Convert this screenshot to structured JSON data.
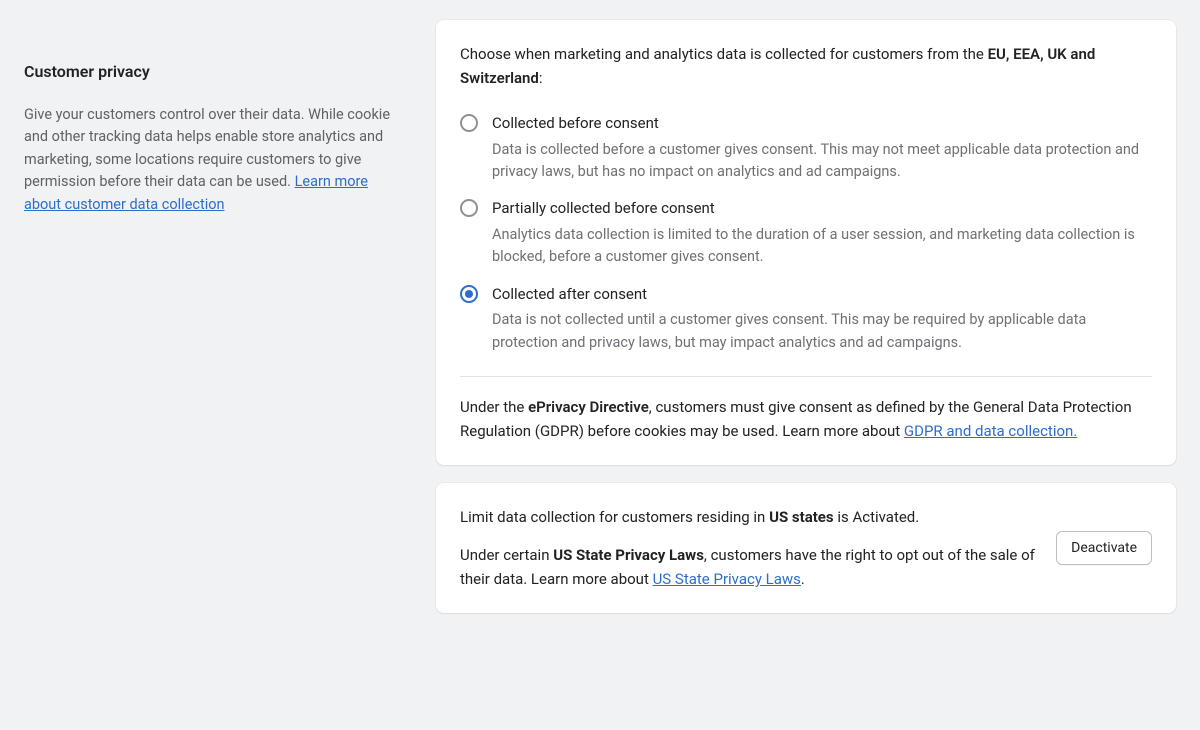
{
  "sidebar": {
    "title": "Customer privacy",
    "description": "Give your customers control over their data. While cookie and other tracking data helps enable store analytics and marketing, some locations require customers to give permission before their data can be used. ",
    "learn_more_link": "Learn more about customer data collection"
  },
  "card1": {
    "intro_prefix": "Choose when marketing and analytics data is collected for customers from the ",
    "intro_bold": "EU, EEA, UK and Switzerland",
    "intro_suffix": ":",
    "options": [
      {
        "label": "Collected before consent",
        "desc": "Data is collected before a customer gives consent. This may not meet applicable data protection and privacy laws, but has no impact on analytics and ad campaigns.",
        "selected": false
      },
      {
        "label": "Partially collected before consent",
        "desc": "Analytics data collection is limited to the duration of a user session, and marketing data collection is blocked, before a customer gives consent.",
        "selected": false
      },
      {
        "label": "Collected after consent",
        "desc": "Data is not collected until a customer gives consent. This may be required by applicable data protection and privacy laws, but may impact analytics and ad campaigns.",
        "selected": true
      }
    ],
    "note_prefix": "Under the ",
    "note_bold": "ePrivacy Directive",
    "note_suffix": ", customers must give consent as defined by the General Data Protection Regulation (GDPR) before cookies may be used. Learn more about ",
    "note_link": "GDPR and data collection."
  },
  "card2": {
    "line1_prefix": "Limit data collection for customers residing in ",
    "line1_bold": "US states",
    "line1_suffix": " is Activated.",
    "line2_prefix": "Under certain ",
    "line2_bold": "US State Privacy Laws",
    "line2_suffix": ", customers have the right to opt out of the sale of their data. Learn more about ",
    "line2_link": "US State Privacy Laws",
    "line2_end": ".",
    "button": "Deactivate"
  }
}
